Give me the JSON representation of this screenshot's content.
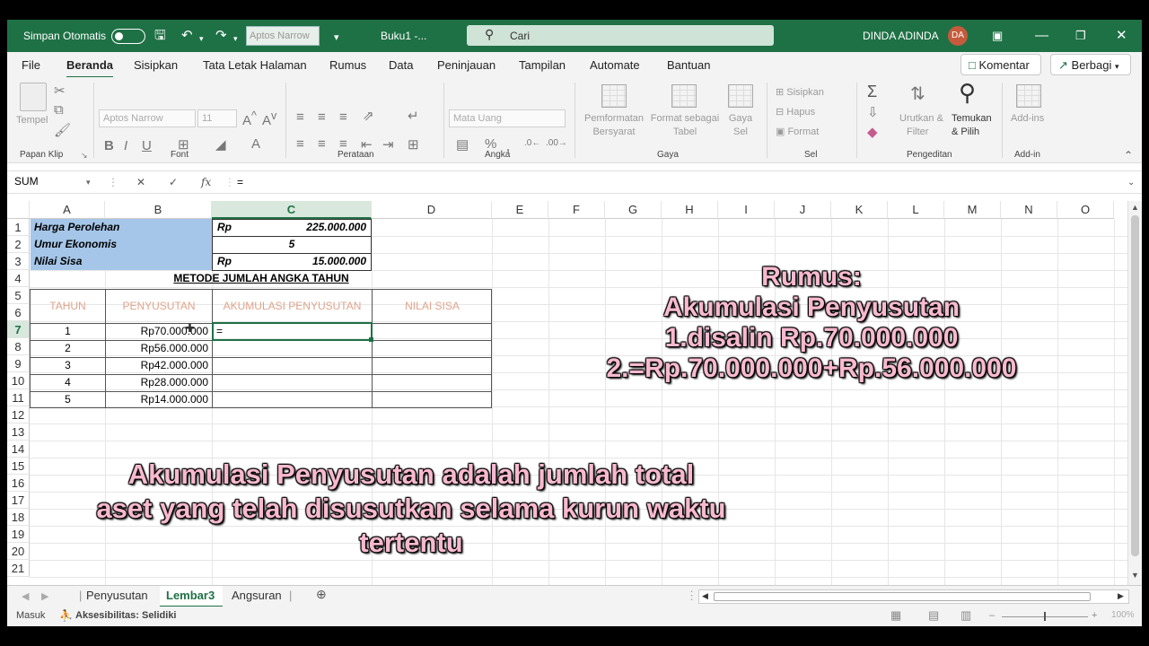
{
  "titlebar": {
    "autosave_label": "Simpan Otomatis",
    "font_name": "Aptos Narrow",
    "doc_name": "Buku1  -...",
    "search_placeholder": "Cari",
    "user_name": "DINDA ADINDA",
    "user_initials": "DA"
  },
  "menu": {
    "items": [
      "File",
      "Beranda",
      "Sisipkan",
      "Tata Letak Halaman",
      "Rumus",
      "Data",
      "Peninjauan",
      "Tampilan",
      "Automate",
      "Bantuan"
    ],
    "comment_label": "Komentar",
    "share_label": "Berbagi"
  },
  "ribbon": {
    "paste_label": "Tempel",
    "font_name": "Aptos Narrow",
    "font_size": "11",
    "number_format": "Mata Uang",
    "cond_format_1": "Pemformatan",
    "cond_format_2": "Bersyarat",
    "format_table_1": "Format sebagai",
    "format_table_2": "Tabel",
    "cell_styles_1": "Gaya",
    "cell_styles_2": "Sel",
    "insert_label": "Sisipkan",
    "delete_label": "Hapus",
    "format_label": "Format",
    "sort_1": "Urutkan &",
    "sort_2": "Filter",
    "find_1": "Temukan",
    "find_2": "& Pilih",
    "addins_label": "Add-ins",
    "groups": {
      "clipboard": "Papan Klip",
      "font": "Font",
      "alignment": "Perataan",
      "number": "Angka",
      "styles": "Gaya",
      "cells": "Sel",
      "editing": "Pengeditan",
      "addin": "Add-in"
    }
  },
  "formula_bar": {
    "name_box": "SUM",
    "formula": "="
  },
  "grid": {
    "columns": [
      "A",
      "B",
      "C",
      "D",
      "E",
      "F",
      "G",
      "H",
      "I",
      "J",
      "K",
      "L",
      "M",
      "N",
      "O"
    ],
    "rows": [
      "1",
      "2",
      "3",
      "4",
      "5",
      "6",
      "7",
      "8",
      "9",
      "10",
      "11",
      "12",
      "13",
      "14",
      "15",
      "16",
      "17",
      "18",
      "19",
      "20",
      "21"
    ],
    "info": {
      "r1_label": "Harga Perolehan",
      "r1_cur": "Rp",
      "r1_value": "225.000.000",
      "r2_label": "Umur Ekonomis",
      "r2_value": "5",
      "r3_label": "Nilai Sisa",
      "r3_cur": "Rp",
      "r3_value": "15.000.000"
    },
    "table_title": "METODE JUMLAH ANGKA TAHUN",
    "headers": [
      "TAHUN",
      "PENYUSUTAN",
      "AKUMULASI PENYUSUTAN",
      "NILAI SISA"
    ],
    "data_rows": [
      {
        "tahun": "1",
        "penyusutan": "Rp70.000.000",
        "akumulasi": "="
      },
      {
        "tahun": "2",
        "penyusutan": "Rp56.000.000",
        "akumulasi": ""
      },
      {
        "tahun": "3",
        "penyusutan": "Rp42.000.000",
        "akumulasi": ""
      },
      {
        "tahun": "4",
        "penyusutan": "Rp28.000.000",
        "akumulasi": ""
      },
      {
        "tahun": "5",
        "penyusutan": "Rp14.000.000",
        "akumulasi": ""
      }
    ]
  },
  "overlay": {
    "rumus_1": "Rumus:",
    "rumus_2": "Akumulasi Penyusutan",
    "rumus_3": "1.disalin Rp.70.000.000",
    "rumus_4": "2.=Rp.70.000.000+Rp.56.000.000",
    "def_1": "Akumulasi Penyusutan adalah jumlah total",
    "def_2": "aset yang telah disusutkan selama kurun waktu",
    "def_3": "tertentu"
  },
  "sheets": {
    "tabs": [
      "Penyusutan",
      "Lembar3",
      "Angsuran"
    ],
    "active": "Lembar3"
  },
  "status": {
    "mode": "Masuk",
    "accessibility": "Aksesibilitas: Selidiki",
    "zoom": "100%"
  },
  "colors": {
    "excel_green": "#1e7145",
    "info_fill": "#a5c6e8",
    "header_text": "#e0a48c",
    "overlay_text": "#f8b9cf"
  }
}
